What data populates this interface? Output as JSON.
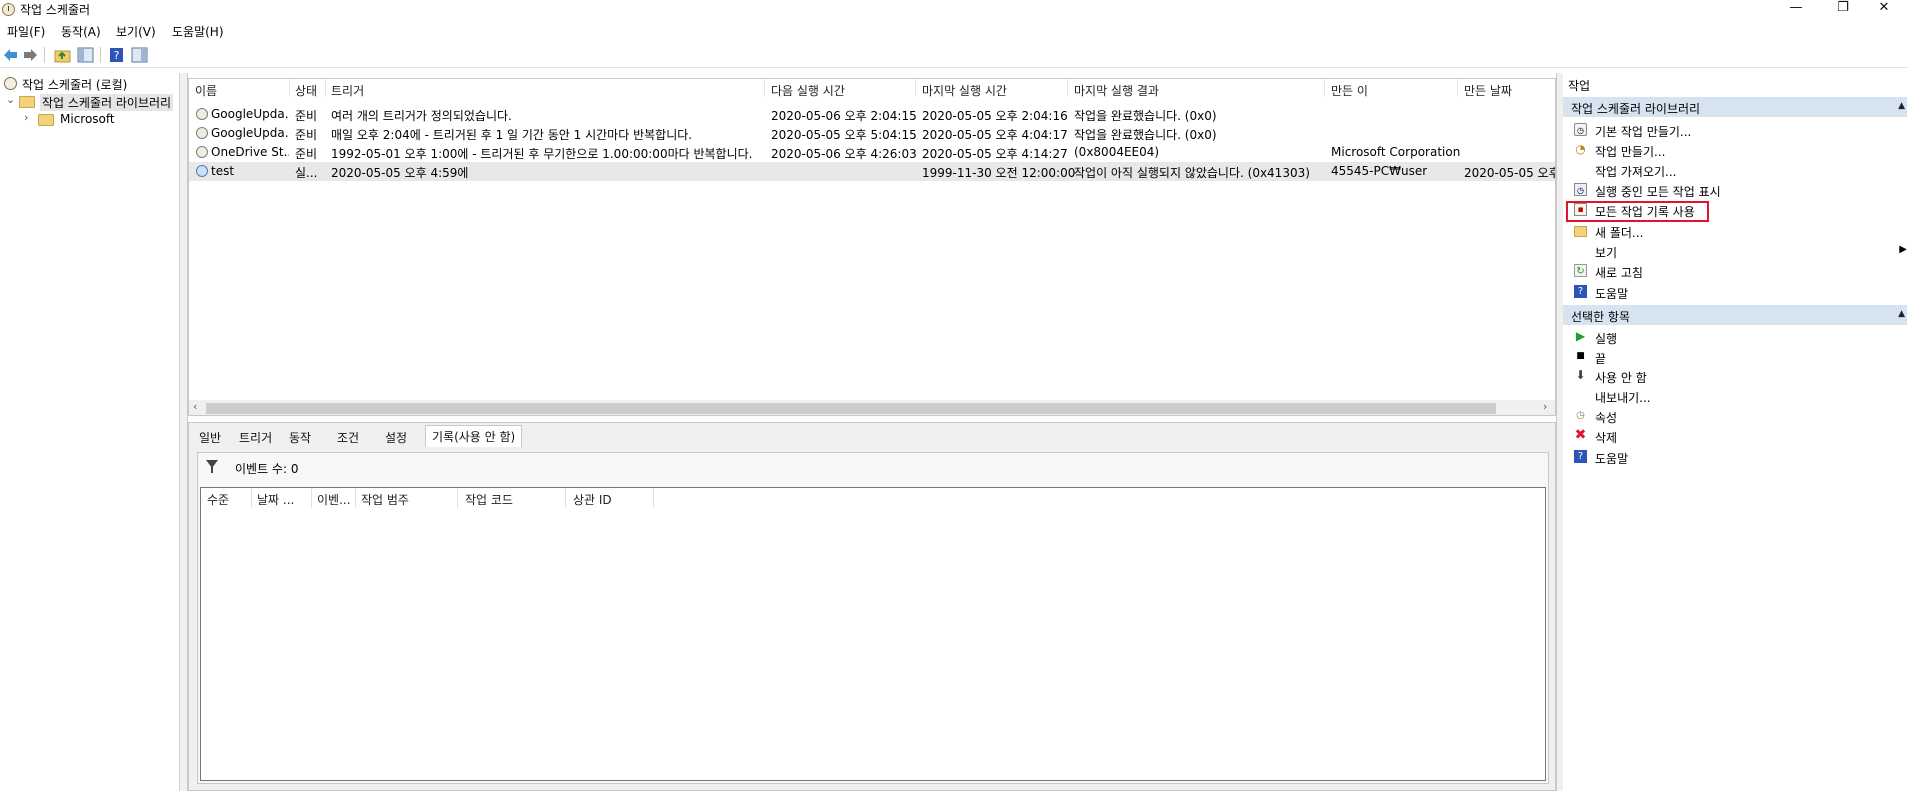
{
  "window": {
    "title": "작업 스케줄러",
    "controls": [
      "—",
      "❐",
      "✕"
    ]
  },
  "menu": [
    "파일(F)",
    "동작(A)",
    "보기(V)",
    "도움말(H)"
  ],
  "tree": {
    "root": "작업 스케줄러 (로컬)",
    "library": "작업 스케줄러 라이브러리",
    "child": "Microsoft"
  },
  "tasks": {
    "columns": [
      "이름",
      "상태",
      "트리거",
      "다음 실행 시간",
      "마지막 실행 시간",
      "마지막 실행 결과",
      "만든 이",
      "만든 날짜"
    ],
    "rows": [
      {
        "name": "GoogleUpda...",
        "status": "준비",
        "trigger": "여러 개의 트리거가 정의되었습니다.",
        "next": "2020-05-06 오후 2:04:15",
        "last": "2020-05-05 오후 2:04:16",
        "result": "작업을 완료했습니다. (0x0)",
        "author": "",
        "created": ""
      },
      {
        "name": "GoogleUpda...",
        "status": "준비",
        "trigger": "매일 오후 2:04에 - 트리거된 후 1 일 기간 동안 1 시간마다 반복합니다.",
        "next": "2020-05-05 오후 5:04:15",
        "last": "2020-05-05 오후 4:04:17",
        "result": "작업을 완료했습니다. (0x0)",
        "author": "",
        "created": ""
      },
      {
        "name": "OneDrive St...",
        "status": "준비",
        "trigger": "1992-05-01 오후 1:00에 - 트리거된 후 무기한으로 1.00:00:00마다 반복합니다.",
        "next": "2020-05-06 오후 4:26:03",
        "last": "2020-05-05 오후 4:14:27",
        "result": "(0x8004EE04)",
        "author": "Microsoft Corporation",
        "created": ""
      },
      {
        "name": "test",
        "status": "실...",
        "trigger": "2020-05-05 오후 4:59에",
        "next": "",
        "last": "1999-11-30 오전 12:00:00",
        "result": "작업이 아직 실행되지 않았습니다. (0x41303)",
        "author": "45545-PC₩user",
        "created": "2020-05-05 오후"
      }
    ]
  },
  "details": {
    "tabs": [
      "일반",
      "트리거",
      "동작",
      "조건",
      "설정",
      "기록(사용 안 함)"
    ],
    "event_count": "이벤트 수: 0",
    "event_columns": [
      "수준",
      "날짜 ...",
      "이벤...",
      "작업 범주",
      "작업 코드",
      "상관 ID"
    ]
  },
  "actions": {
    "title": "작업",
    "sections": [
      {
        "header": "작업 스케줄러 라이브러리",
        "items": [
          {
            "label": "기본 작업 만들기...",
            "icon": "create-basic-task-icon"
          },
          {
            "label": "작업 만들기...",
            "icon": "create-task-icon"
          },
          {
            "label": "작업 가져오기...",
            "icon": ""
          },
          {
            "label": "실행 중인 모든 작업 표시",
            "icon": "running-tasks-icon"
          },
          {
            "label": "모든 작업 기록 사용",
            "icon": "enable-history-icon"
          },
          {
            "label": "새 폴더...",
            "icon": "new-folder-icon"
          },
          {
            "label": "보기",
            "icon": ""
          },
          {
            "label": "새로 고침",
            "icon": "refresh-icon"
          },
          {
            "label": "도움말",
            "icon": "help-icon"
          }
        ]
      },
      {
        "header": "선택한 항목",
        "items": [
          {
            "label": "실행",
            "icon": "run-icon"
          },
          {
            "label": "끝",
            "icon": "end-icon"
          },
          {
            "label": "사용 안 함",
            "icon": "disable-icon"
          },
          {
            "label": "내보내기...",
            "icon": ""
          },
          {
            "label": "속성",
            "icon": "properties-icon"
          },
          {
            "label": "삭제",
            "icon": "delete-icon"
          },
          {
            "label": "도움말",
            "icon": "help-icon"
          }
        ]
      }
    ]
  },
  "colors": {
    "section_header": "#d6e4f2",
    "highlight": "#e0142d",
    "selected_row": "#e8e8e8"
  }
}
